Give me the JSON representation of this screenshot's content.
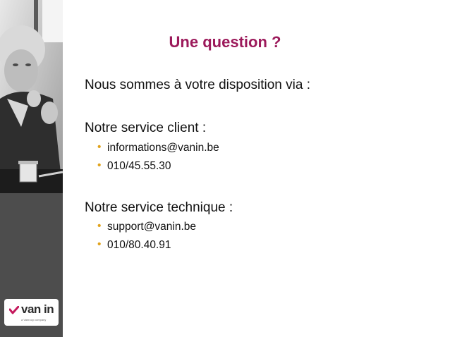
{
  "title": "Une question ?",
  "intro": "Nous sommes à votre disposition via :",
  "sections": [
    {
      "heading": "Notre service client :",
      "items": [
        "informations@vanin.be",
        "010/45.55.30"
      ]
    },
    {
      "heading": "Notre service technique :",
      "items": [
        "support@vanin.be",
        "010/80.40.91"
      ]
    }
  ],
  "logo": {
    "name": "van in",
    "tagline": "a Vanrooy company"
  },
  "colors": {
    "title": "#9c1a5b",
    "bullet": "#e0a21b",
    "sidebar": "#4d4d4d",
    "logo_check": "#c4185c"
  }
}
